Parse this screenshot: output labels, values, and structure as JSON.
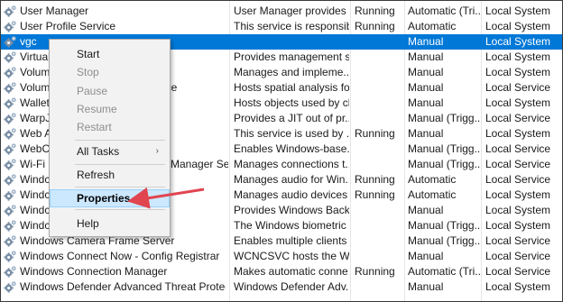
{
  "services": [
    {
      "name": "User Manager",
      "description": "User Manager provides ...",
      "status": "Running",
      "startup": "Automatic (Tri...",
      "logon": "Local System"
    },
    {
      "name": "User Profile Service",
      "description": "This service is responsib...",
      "status": "Running",
      "startup": "Automatic",
      "logon": "Local System"
    },
    {
      "name": "vgc",
      "description": "",
      "status": "",
      "startup": "Manual",
      "logon": "Local System",
      "selected": true
    },
    {
      "name": "Virtual",
      "description": "Provides management s...",
      "status": "",
      "startup": "Manual",
      "logon": "Local System"
    },
    {
      "name": "Volum",
      "description": "Manages and impleme...",
      "status": "",
      "startup": "Manual",
      "logon": "Local System"
    },
    {
      "name": "Volum",
      "name_suffix": "ice",
      "description": "Hosts spatial analysis fo...",
      "status": "",
      "startup": "Manual",
      "logon": "Local Service"
    },
    {
      "name": "Wallet",
      "description": "Hosts objects used by cl...",
      "status": "",
      "startup": "Manual",
      "logon": "Local System"
    },
    {
      "name": "WarpJ",
      "description": "Provides a JIT out of pr...",
      "status": "",
      "startup": "Manual (Trigg...",
      "logon": "Local Service"
    },
    {
      "name": "Web A",
      "description": "This service is used by ...",
      "status": "Running",
      "startup": "Manual",
      "logon": "Local System"
    },
    {
      "name": "WebCl",
      "description": "Enables Windows-base...",
      "status": "",
      "startup": "Manual (Trigg...",
      "logon": "Local Service"
    },
    {
      "name": "Wi-Fi I",
      "name_suffix": "Manager Ser...",
      "description": "Manages connections t...",
      "status": "",
      "startup": "Manual (Trigg...",
      "logon": "Local Service"
    },
    {
      "name": "Windc",
      "description": "Manages audio for Win...",
      "status": "Running",
      "startup": "Automatic",
      "logon": "Local Service"
    },
    {
      "name": "Windc",
      "description": "Manages audio devices ...",
      "status": "Running",
      "startup": "Automatic",
      "logon": "Local System"
    },
    {
      "name": "Windc",
      "description": "Provides Windows Back...",
      "status": "",
      "startup": "Manual",
      "logon": "Local System"
    },
    {
      "name": "Windc",
      "description": "The Windows biometric ...",
      "status": "",
      "startup": "Manual (Trigg...",
      "logon": "Local System"
    },
    {
      "name": "Windows Camera Frame Server",
      "description": "Enables multiple clients ...",
      "status": "",
      "startup": "Manual (Trigg...",
      "logon": "Local Service"
    },
    {
      "name": "Windows Connect Now - Config Registrar",
      "description": "WCNCSVC hosts the Wi...",
      "status": "",
      "startup": "Manual",
      "logon": "Local Service"
    },
    {
      "name": "Windows Connection Manager",
      "description": "Makes automatic conne...",
      "status": "Running",
      "startup": "Automatic (Tri...",
      "logon": "Local Service"
    },
    {
      "name": "Windows Defender Advanced Threat Protectio...",
      "description": "Windows Defender Adv...",
      "status": "",
      "startup": "Manual",
      "logon": "Local System"
    }
  ],
  "context_menu": {
    "start": "Start",
    "stop": "Stop",
    "pause": "Pause",
    "resume": "Resume",
    "restart": "Restart",
    "all_tasks": "All Tasks",
    "all_tasks_arrow": "›",
    "refresh": "Refresh",
    "properties": "Properties",
    "help": "Help"
  },
  "colors": {
    "selection": "#0078d7",
    "menu_highlight": "#cce8ff",
    "annotation_arrow": "#e04550"
  },
  "icons": {
    "service": "gear-icon"
  }
}
